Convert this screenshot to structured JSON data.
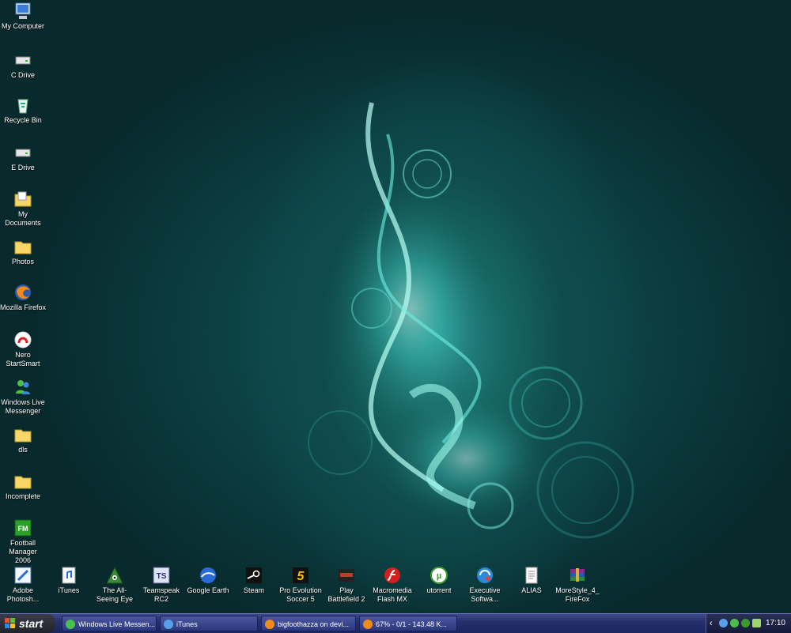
{
  "desktop_left": [
    {
      "label": "My Computer",
      "icon": "my-computer-icon"
    },
    {
      "label": "C Drive",
      "icon": "drive-icon"
    },
    {
      "label": "Recycle Bin",
      "icon": "recycle-bin-icon"
    },
    {
      "label": "E Drive",
      "icon": "drive-icon"
    },
    {
      "label": "My Documents",
      "icon": "my-documents-icon"
    },
    {
      "label": "Photos",
      "icon": "folder-icon"
    },
    {
      "label": "Mozilla Firefox",
      "icon": "firefox-icon"
    },
    {
      "label": "Nero StartSmart",
      "icon": "nero-icon"
    },
    {
      "label": "Windows Live Messenger",
      "icon": "messenger-icon"
    },
    {
      "label": "dls",
      "icon": "folder-icon"
    },
    {
      "label": "Incomplete",
      "icon": "folder-icon"
    },
    {
      "label": "Football Manager 2006",
      "icon": "football-manager-icon"
    },
    {
      "label": "Adobe Photosh...",
      "icon": "photoshop-icon"
    }
  ],
  "desktop_bottom": [
    {
      "label": "iTunes",
      "icon": "itunes-icon"
    },
    {
      "label": "The All-Seeing Eye",
      "icon": "all-seeing-eye-icon"
    },
    {
      "label": "Teamspeak RC2",
      "icon": "teamspeak-icon"
    },
    {
      "label": "Google Earth",
      "icon": "google-earth-icon"
    },
    {
      "label": "Steam",
      "icon": "steam-icon"
    },
    {
      "label": "Pro Evolution Soccer 5",
      "icon": "pes5-icon"
    },
    {
      "label": "Play Battlefield 2",
      "icon": "battlefield-icon"
    },
    {
      "label": "Macromedia Flash MX",
      "icon": "flash-icon"
    },
    {
      "label": "utorrent",
      "icon": "utorrent-icon"
    },
    {
      "label": "Executive Softwa...",
      "icon": "executive-software-icon"
    },
    {
      "label": "ALIAS",
      "icon": "text-file-icon"
    },
    {
      "label": "MoreStyle_4_FireFox",
      "icon": "winrar-icon"
    }
  ],
  "taskbar": {
    "start_label": "start",
    "tasks": [
      {
        "label": "Windows Live Messen...",
        "icon": "messenger-icon"
      },
      {
        "label": "iTunes",
        "icon": "itunes-icon"
      },
      {
        "label": "bigfoothazza on devi...",
        "icon": "firefox-icon"
      },
      {
        "label": "67% - 0/1 - 143.48 K...",
        "icon": "firefox-icon"
      }
    ],
    "clock": "17:10"
  },
  "colors": {
    "accent": "#2fd2c8",
    "taskbar": "#25306b"
  }
}
